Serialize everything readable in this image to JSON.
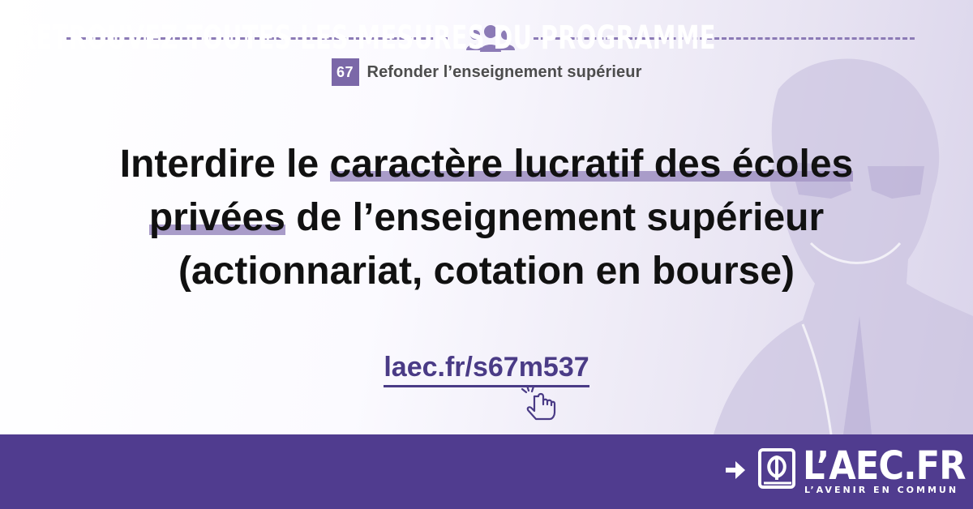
{
  "category": {
    "number": "67",
    "title": "Refonder l’enseignement supérieur"
  },
  "headline": {
    "part1": "Interdire le ",
    "highlight1": "caractère lucratif des écoles",
    "highlight2": "privées",
    "part2": " de l’enseignement supérieur",
    "part3": "(actionnariat, cotation en bourse)"
  },
  "link": {
    "text": "laec.fr/s67m537"
  },
  "banner": {
    "text": "RETROUVEZ TOUTES LES MESURES DU PROGRAMME",
    "logo": "L’AEC.FR",
    "tagline": "L’AVENIR EN COMMUN"
  },
  "colors": {
    "accent": "#503c8f",
    "highlight": "#a99cc9",
    "badge": "#7b68a8"
  },
  "icons": [
    "people-icon",
    "pointer-hand-icon",
    "arrow-right-icon",
    "aec-logo-icon"
  ]
}
